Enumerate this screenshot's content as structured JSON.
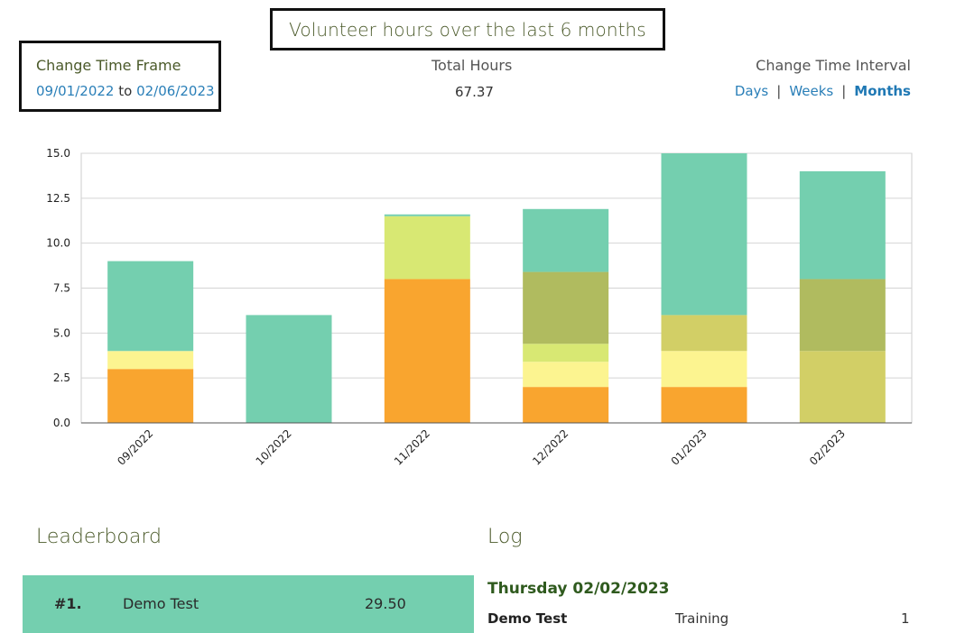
{
  "header": {
    "title": "Volunteer hours over the last 6 months"
  },
  "time_frame": {
    "label": "Change Time Frame",
    "start": "09/01/2022",
    "joiner": "to",
    "end": "02/06/2023"
  },
  "totals": {
    "label": "Total Hours",
    "value": "67.37"
  },
  "interval": {
    "label": "Change Time Interval",
    "options": [
      "Days",
      "Weeks",
      "Months"
    ],
    "selected": "Months",
    "separator": "|"
  },
  "chart_data": {
    "type": "bar",
    "stacked": true,
    "categories": [
      "09/2022",
      "10/2022",
      "11/2022",
      "12/2022",
      "01/2023",
      "02/2023"
    ],
    "ylim": [
      0,
      15
    ],
    "yticks": [
      "0.0",
      "2.5",
      "5.0",
      "7.5",
      "10.0",
      "12.5",
      "15.0"
    ],
    "grid": true,
    "series": [
      {
        "color": "#f9a52f",
        "values": [
          3,
          0,
          8,
          2,
          2,
          0
        ]
      },
      {
        "color": "#fcf490",
        "values": [
          1,
          0,
          0,
          1.4,
          2,
          0
        ]
      },
      {
        "color": "#d8e873",
        "values": [
          0,
          0,
          3.5,
          1,
          0,
          0
        ]
      },
      {
        "color": "#d2cf66",
        "values": [
          0,
          0,
          0,
          0,
          2,
          4
        ]
      },
      {
        "color": "#b0bb5f",
        "values": [
          0,
          0,
          0,
          4,
          0,
          4
        ]
      },
      {
        "color": "#74cfaf",
        "values": [
          5,
          6,
          0.1,
          3.5,
          9,
          6
        ]
      }
    ]
  },
  "leaderboard": {
    "title": "Leaderboard",
    "rows": [
      {
        "rank": "#1.",
        "name": "Demo Test",
        "hours": "29.50"
      }
    ]
  },
  "log": {
    "title": "Log",
    "date": "Thursday 02/02/2023",
    "entries": [
      {
        "name": "Demo Test",
        "activity": "Training",
        "hours": "1"
      }
    ]
  }
}
